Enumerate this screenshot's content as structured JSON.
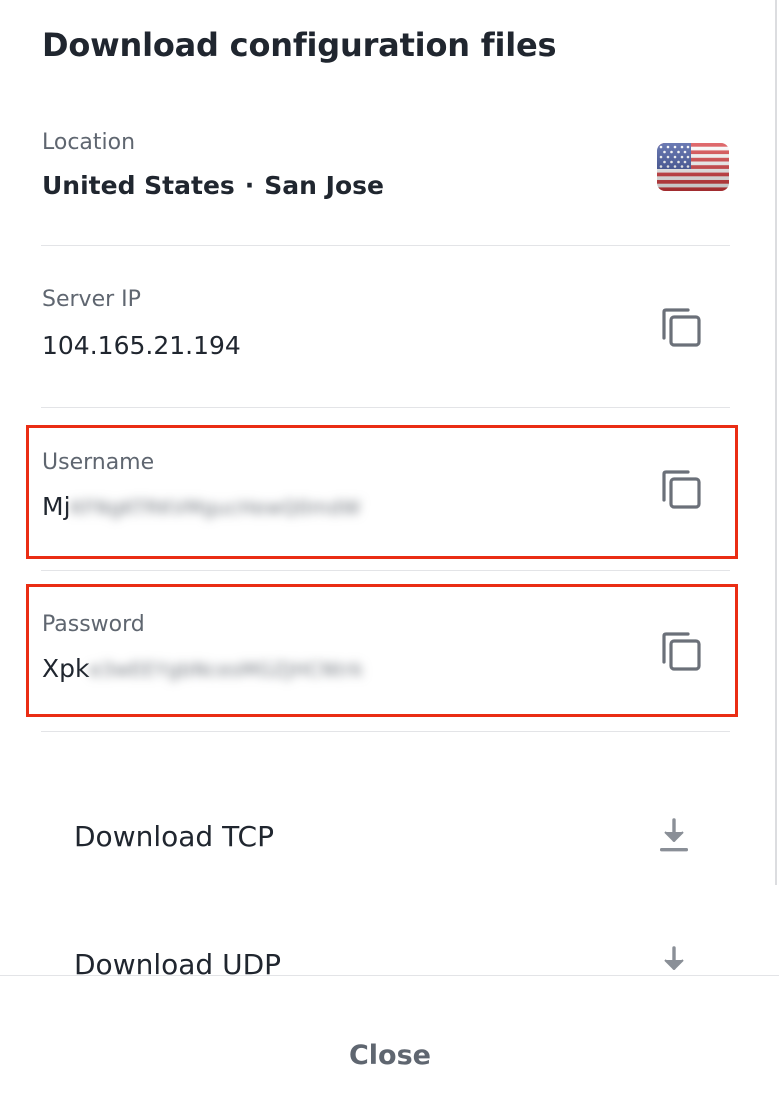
{
  "dialog": {
    "title": "Download configuration files",
    "close_label": "Close"
  },
  "location": {
    "label": "Location",
    "country": "United States",
    "separator": "·",
    "city": "San Jose",
    "flag_icon": "us-flag-icon"
  },
  "server_ip": {
    "label": "Server IP",
    "value": "104.165.21.194",
    "copy_icon": "copy-icon"
  },
  "username": {
    "label": "Username",
    "visible_prefix": "Mj",
    "redacted_rest": "KFNgKTRKVMgucHewQ0mdW",
    "copy_icon": "copy-icon"
  },
  "password": {
    "label": "Password",
    "visible_prefix": "Xpk",
    "redacted_rest": "e3wEEYgbNcesMGZJHCNtrk",
    "copy_icon": "copy-icon"
  },
  "downloads": [
    {
      "label": "Download TCP",
      "icon": "download-icon"
    },
    {
      "label": "Download UDP",
      "icon": "download-icon"
    }
  ],
  "colors": {
    "highlight_border": "#ea2d14",
    "text_primary": "#20262f",
    "text_secondary": "#5f6670",
    "icon": "#6b7079"
  }
}
